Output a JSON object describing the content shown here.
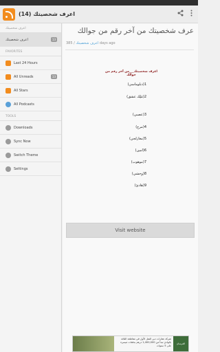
{
  "action_bar": {
    "title": "اعرف شخصيتك (14)",
    "share_icon": "share-icon",
    "overflow_icon": "overflow-icon"
  },
  "drawer": {
    "feed_section": "اعرف شخصيتك",
    "feed_item": {
      "label": "اعرف شخصيتك",
      "count": "13"
    },
    "favorites_section": "FAVORITES",
    "favorites": [
      {
        "label": "Last 24 Hours",
        "count": ""
      },
      {
        "label": "All Unreads",
        "count": "13"
      },
      {
        "label": "All Stars",
        "count": ""
      },
      {
        "label": "All Podcasts",
        "count": ""
      }
    ],
    "tools_section": "TOOLS",
    "tools": [
      {
        "label": "Downloads"
      },
      {
        "label": "Sync Now"
      },
      {
        "label": "Switch Theme"
      },
      {
        "label": "Settings"
      }
    ]
  },
  "article": {
    "title": "عرف شخصيتك من آخر رقم من جوالك",
    "feed_name": "اعرف شخصيتك",
    "meta_prefix": "385 / ",
    "meta_suffix": " days ago",
    "headline": "اعرف شخصيتك___من آخر رقم من جوالك",
    "items": [
      "1(دبلوماسي)",
      "2(مَلِك عشق)",
      "3(عصبي)",
      "4(مرح)",
      "5(مغازلجي)",
      "6(امين)",
      "7(موهوب)",
      "8(وحشي)",
      "9(هادئ)"
    ],
    "visit_button": "Visit website"
  },
  "ad": {
    "text": "شركة عقارات دبي النفل الأول في مقاطعة الثلاثة بالوادي تبدأ من 1,400,000 درهم بدفعات ميسرة على 5 سنوات",
    "logo": "الفرسان"
  }
}
